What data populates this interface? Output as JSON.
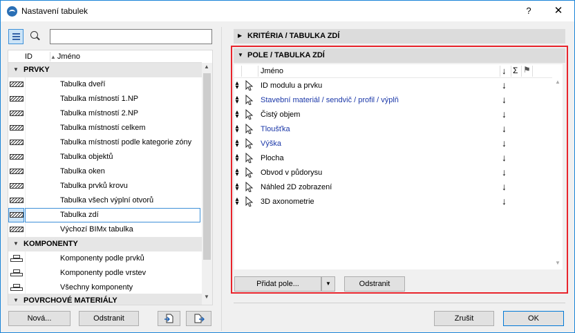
{
  "window": {
    "title": "Nastavení tabulek",
    "help": "?",
    "close": "✕"
  },
  "search": {
    "value": "",
    "placeholder": ""
  },
  "left": {
    "col_id": "ID",
    "col_name": "Jméno",
    "sort_glyph": "▲",
    "groups": [
      {
        "label": "PRVKY"
      },
      {
        "label": "KOMPONENTY"
      },
      {
        "label": "POVRCHOVÉ MATERIÁLY"
      }
    ],
    "items": [
      {
        "label": "Tabulka dveří"
      },
      {
        "label": "Tabulka místností 1.NP"
      },
      {
        "label": "Tabulka místností 2.NP"
      },
      {
        "label": "Tabulka místností celkem"
      },
      {
        "label": "Tabulka místností podle kategorie zóny"
      },
      {
        "label": "Tabulka objektů"
      },
      {
        "label": "Tabulka oken"
      },
      {
        "label": "Tabulka prvků krovu"
      },
      {
        "label": "Tabulka všech výplní otvorů"
      },
      {
        "label": "Tabulka zdí"
      },
      {
        "label": "Výchozí BIMx tabulka"
      },
      {
        "label": "Komponenty podle prvků"
      },
      {
        "label": "Komponenty podle vrstev"
      },
      {
        "label": "Všechny komponenty"
      }
    ],
    "selected_index": 9,
    "new_button": "Nová...",
    "delete_button": "Odstranit"
  },
  "right": {
    "criteria_section": "KRITÉRIA / TABULKA ZDÍ",
    "fields_section": "POLE / TABULKA ZDÍ",
    "header_name": "Jméno",
    "header_arrow": "↓",
    "header_sum": "Σ",
    "header_flag": "⚑",
    "fields": [
      {
        "label": "ID modulu a prvku",
        "color": "#000000"
      },
      {
        "label": "Stavební materiál / sendvič / profil / výplň",
        "color": "#1a37a8"
      },
      {
        "label": "Čistý objem",
        "color": "#000000"
      },
      {
        "label": "Tloušťka",
        "color": "#1a37a8"
      },
      {
        "label": "Výška",
        "color": "#1a37a8"
      },
      {
        "label": "Plocha",
        "color": "#000000"
      },
      {
        "label": "Obvod v půdorysu",
        "color": "#000000"
      },
      {
        "label": "Náhled 2D zobrazení",
        "color": "#000000"
      },
      {
        "label": "3D axonometrie",
        "color": "#000000"
      }
    ],
    "row_arrow": "↓",
    "add_field_button": "Přidat pole...",
    "add_field_dropdown": "▼",
    "delete_button": "Odstranit"
  },
  "footer": {
    "cancel": "Zrušit",
    "ok": "OK"
  },
  "colors": {
    "accent": "#0078d7",
    "highlight_frame": "#e8232b",
    "link_text": "#1a37a8",
    "selection": "#cce4f7"
  }
}
